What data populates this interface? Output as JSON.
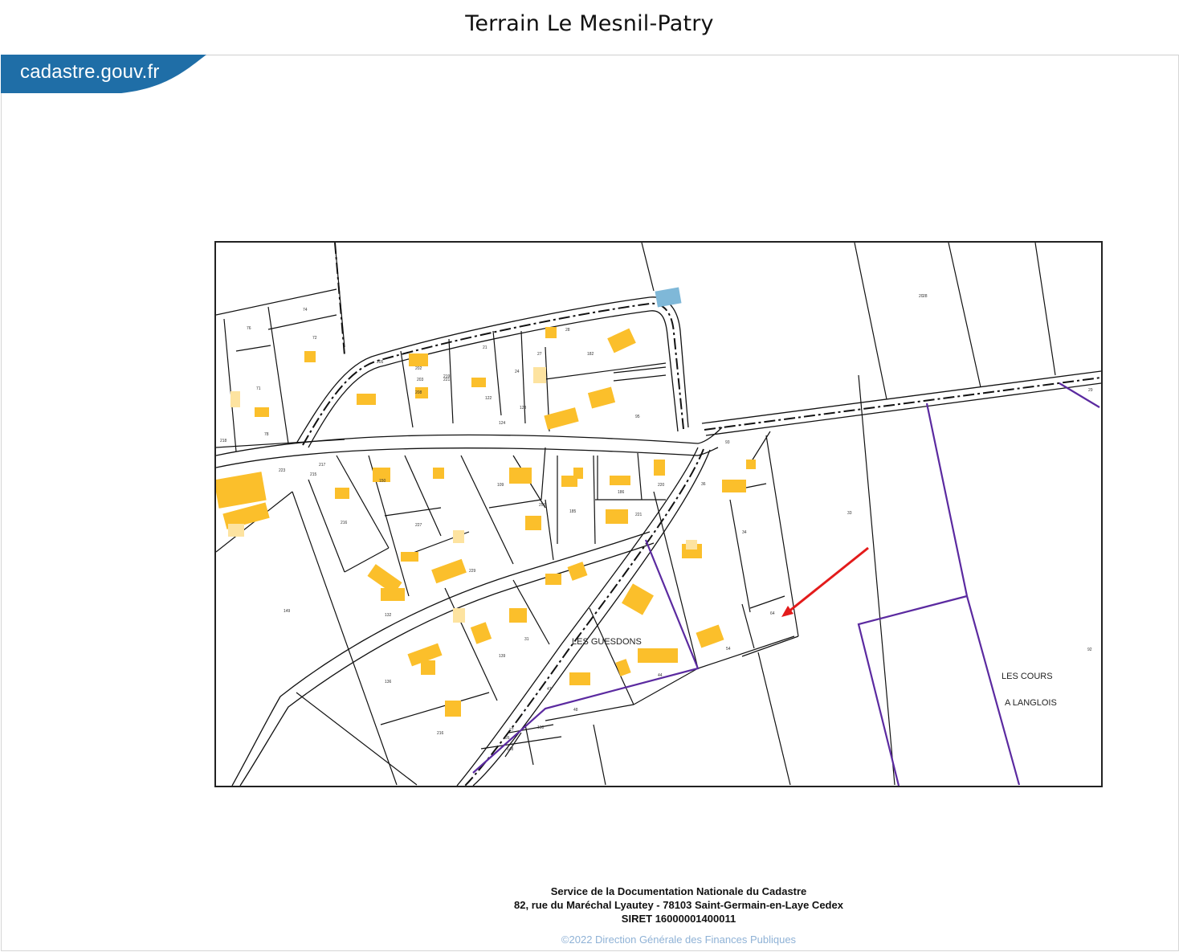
{
  "page": {
    "title": "Terrain Le Mesnil-Patry"
  },
  "logo": {
    "text": "cadastre.gouv.fr",
    "color": "#1f6ea7"
  },
  "map": {
    "places": [
      "LES GUESDONS",
      "LES COURS",
      "A LANGLOIS"
    ],
    "parcel_labels": [
      "74",
      "76",
      "72",
      "71",
      "78",
      "205",
      "28",
      "182",
      "24",
      "27",
      "21",
      "202",
      "203",
      "219",
      "208",
      "221",
      "122",
      "124",
      "123",
      "95",
      "93",
      "92",
      "33",
      "20",
      "36",
      "34",
      "64",
      "54",
      "44",
      "48",
      "47",
      "31",
      "139",
      "136",
      "132",
      "149",
      "216",
      "150",
      "227",
      "229",
      "109",
      "256",
      "185",
      "186",
      "220",
      "221",
      "223",
      "215",
      "217",
      "218",
      "216",
      "138",
      "148",
      "26",
      "27",
      "28",
      "29",
      "30",
      "8",
      "21"
    ],
    "highlight_parcel": "54",
    "arrow_color": "#e31b1b",
    "building_color": "#fbbf2b",
    "boundary_color": "#5b2aa0"
  },
  "footer": {
    "line1": "Service de la Documentation Nationale du Cadastre",
    "line2": "82, rue du Maréchal Lyautey - 78103 Saint-Germain-en-Laye Cedex",
    "line3": "SIRET 16000001400011",
    "copyright": "©2022 Direction Générale des Finances Publiques"
  }
}
